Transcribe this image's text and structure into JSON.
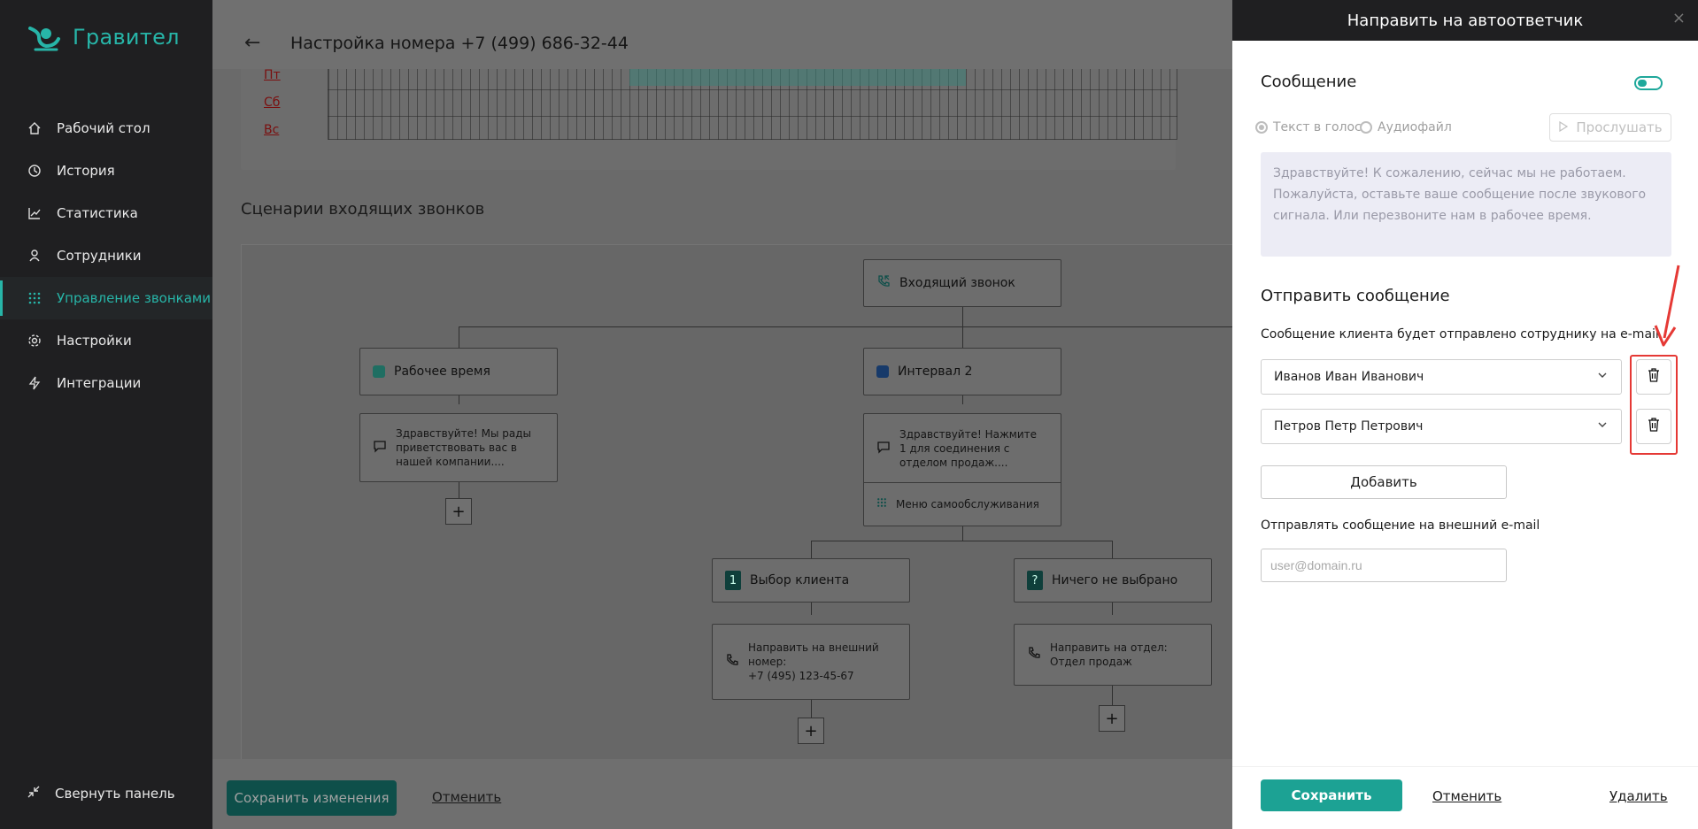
{
  "sidebar": {
    "logo": "Гравител",
    "items": [
      {
        "label": "Рабочий стол",
        "icon": "home-icon"
      },
      {
        "label": "История",
        "icon": "history-icon"
      },
      {
        "label": "Статистика",
        "icon": "chart-icon"
      },
      {
        "label": "Сотрудники",
        "icon": "user-icon"
      },
      {
        "label": "Управление звонками",
        "icon": "dialpad-icon",
        "active": true
      },
      {
        "label": "Настройки",
        "icon": "gear-icon"
      },
      {
        "label": "Интеграции",
        "icon": "lightning-icon"
      }
    ],
    "collapse_label": "Свернуть панель",
    "accent_color": "#27b5a8"
  },
  "main": {
    "title": "Настройка номера +7 (499) 686-32-44",
    "schedule_days": [
      "Пт",
      "Сб",
      "Вс"
    ],
    "scenarios_title": "Сценарии входящих звонков",
    "nodes": {
      "incoming": "Входящий звонок",
      "work_time": "Рабочее время",
      "interval2": "Интервал 2",
      "greeting1": "Здравствуйте! Мы рады приветствовать вас в нашей компании....",
      "greeting2": "Здравствуйте! Нажмите 1 для соединения с отделом продаж....",
      "self_service": "Меню самообслуживания",
      "choice_client": "Выбор клиента",
      "nothing_selected": "Ничего не выбрано",
      "choice_num": "1",
      "nothing_num": "?",
      "redirect_ext": "Направить на внешний номер:",
      "ext_number": "+7 (495) 123-45-67",
      "redirect_dept": "Направить на отдел:",
      "dept_name": "Отдел продаж"
    },
    "save_button": "Сохранить изменения",
    "cancel_link": "Отменить"
  },
  "panel": {
    "title": "Направить на автоответчик",
    "close": "×",
    "message_label": "Сообщение",
    "message_enabled": true,
    "radio_tts": "Текст в голос",
    "radio_audio": "Аудиофайл",
    "listen_button": "Прослушать",
    "message_text": "Здравствуйте! К сожалению, сейчас мы не работаем. Пожалуйста, оставьте ваше сообщение после звукового сигнала. Или перезвоните нам в рабочее время.",
    "send_title": "Отправить сообщение",
    "send_desc": "Сообщение клиента будет отправлено сотруднику на e-mail",
    "employees": [
      "Иванов Иван Иванович",
      "Петров Петр Петрович"
    ],
    "add_button": "Добавить",
    "external_label": "Отправлять сообщение на внешний e-mail",
    "external_placeholder": "user@domain.ru",
    "save_button": "Сохранить",
    "cancel_link": "Отменить",
    "delete_link": "Удалить",
    "accent_color": "#1ca294",
    "annotation_color": "#e53935"
  }
}
